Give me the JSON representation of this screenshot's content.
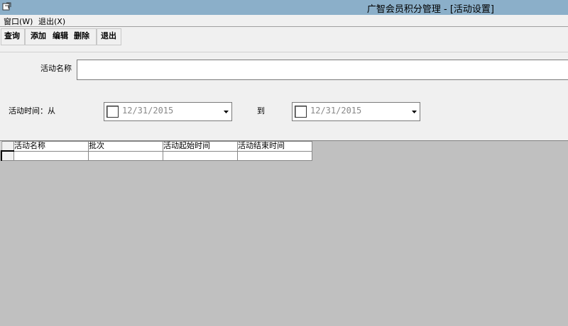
{
  "window": {
    "title": "广智会员积分管理 - [活动设置]",
    "icon": "app-window-icon"
  },
  "menu": {
    "window_label": "窗口(W)",
    "exit_label": "退出(X)"
  },
  "toolbar": {
    "query_label": "查询",
    "add_label": "添加",
    "edit_label": "编辑",
    "delete_label": "删除",
    "exit_label": "退出"
  },
  "form": {
    "activity_name_label": "活动名称",
    "activity_name_value": "",
    "time_from_label": "活动时间：从",
    "date_from_value": "12/31/2015",
    "to_label": "到",
    "date_to_value": "12/31/2015"
  },
  "grid": {
    "columns": [
      "活动名称",
      "批次",
      "活动起始时间",
      "活动结束时间"
    ],
    "rows": [
      [
        "",
        "",
        "",
        ""
      ]
    ]
  },
  "colors": {
    "titlebar": "#8bafc9",
    "background": "#f0f0f0",
    "grid_background": "#c0c0c0"
  }
}
